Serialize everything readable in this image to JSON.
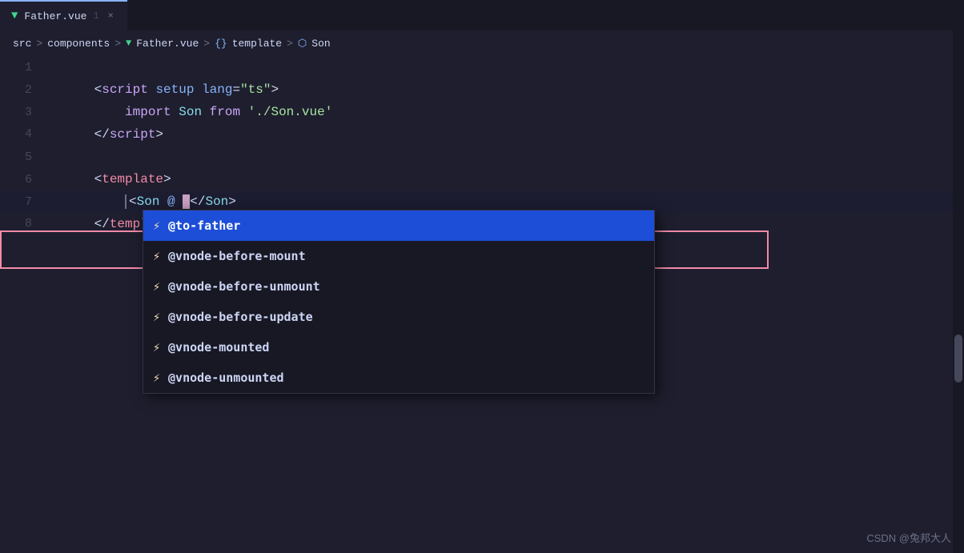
{
  "tab": {
    "vue_icon": "▼",
    "filename": "Father.vue",
    "number": "1",
    "close_icon": "×"
  },
  "breadcrumb": {
    "src": "src",
    "sep1": ">",
    "components": "components",
    "sep2": ">",
    "vue_icon": "▼",
    "file": "Father.vue",
    "sep3": ">",
    "curly": "{}",
    "template_label": "template",
    "sep4": ">",
    "component_icon": "⬡",
    "component_name": "Son"
  },
  "lines": [
    {
      "num": "1",
      "content": ""
    },
    {
      "num": "2",
      "content": ""
    },
    {
      "num": "3",
      "content": ""
    },
    {
      "num": "4",
      "content": ""
    },
    {
      "num": "5",
      "content": ""
    },
    {
      "num": "6",
      "content": ""
    },
    {
      "num": "7",
      "content": ""
    },
    {
      "num": "8",
      "content": ""
    }
  ],
  "autocomplete": {
    "items": [
      {
        "icon": "⚡",
        "label": "@to-father",
        "selected": true
      },
      {
        "icon": "⚡",
        "label": "@vnode-before-mount",
        "selected": false
      },
      {
        "icon": "⚡",
        "label": "@vnode-before-unmount",
        "selected": false
      },
      {
        "icon": "⚡",
        "label": "@vnode-before-update",
        "selected": false
      },
      {
        "icon": "⚡",
        "label": "@vnode-mounted",
        "selected": false
      },
      {
        "icon": "⚡",
        "label": "@vnode-unmounted",
        "selected": false
      }
    ]
  },
  "watermark": {
    "text": "CSDN @兔邦大人"
  }
}
